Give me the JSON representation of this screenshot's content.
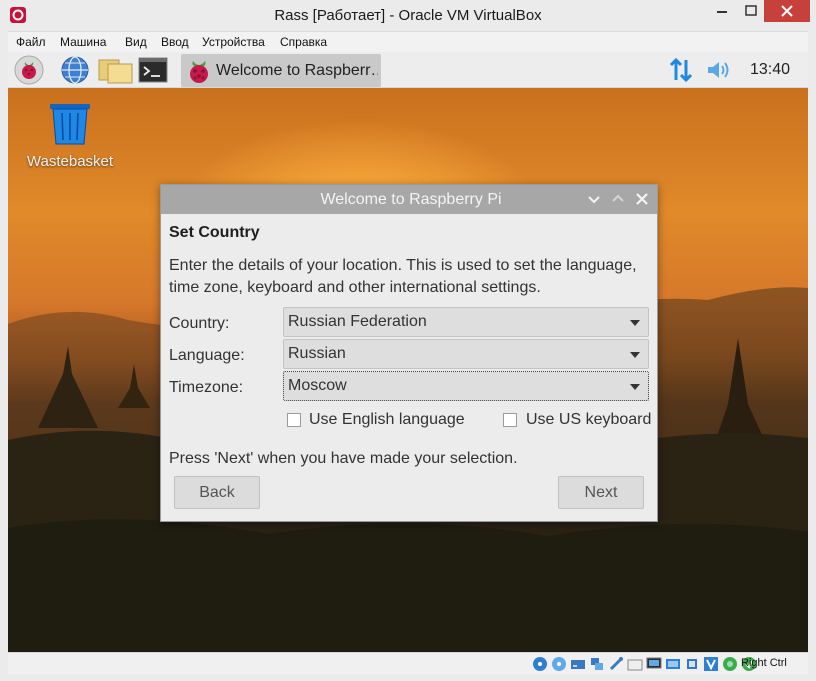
{
  "window": {
    "title": "Rass [Работает] - Oracle VM VirtualBox"
  },
  "menubar": [
    "Файл",
    "Машина",
    "Вид",
    "Ввод",
    "Устройства",
    "Справка"
  ],
  "taskbar": {
    "launchers": [
      "raspberry-menu-icon",
      "web-browser-icon",
      "file-manager-icon",
      "terminal-icon"
    ],
    "active_task": "Welcome to Raspberr…",
    "clock": "13:40"
  },
  "desktop": {
    "icons": [
      {
        "label": "Wastebasket",
        "icon": "wastebasket-icon"
      }
    ]
  },
  "dialog": {
    "title": "Welcome to Raspberry Pi",
    "heading": "Set Country",
    "description": "Enter the details of your location. This is used to set the language, time zone, keyboard and other international settings.",
    "fields": [
      {
        "label": "Country:",
        "value": "Russian Federation"
      },
      {
        "label": "Language:",
        "value": "Russian"
      },
      {
        "label": "Timezone:",
        "value": "Moscow"
      }
    ],
    "checkboxes": [
      {
        "label": "Use English language",
        "checked": false
      },
      {
        "label": "Use US keyboard",
        "checked": false
      }
    ],
    "footer": "Press 'Next' when you have made your selection.",
    "back_label": "Back",
    "next_label": "Next"
  },
  "statusbar": {
    "host_key": "Right Ctrl"
  },
  "colors": {
    "close_button": "#c7413c",
    "tray_blue": "#1e88e5",
    "dialog_title_bg": "#a7a7a7"
  }
}
